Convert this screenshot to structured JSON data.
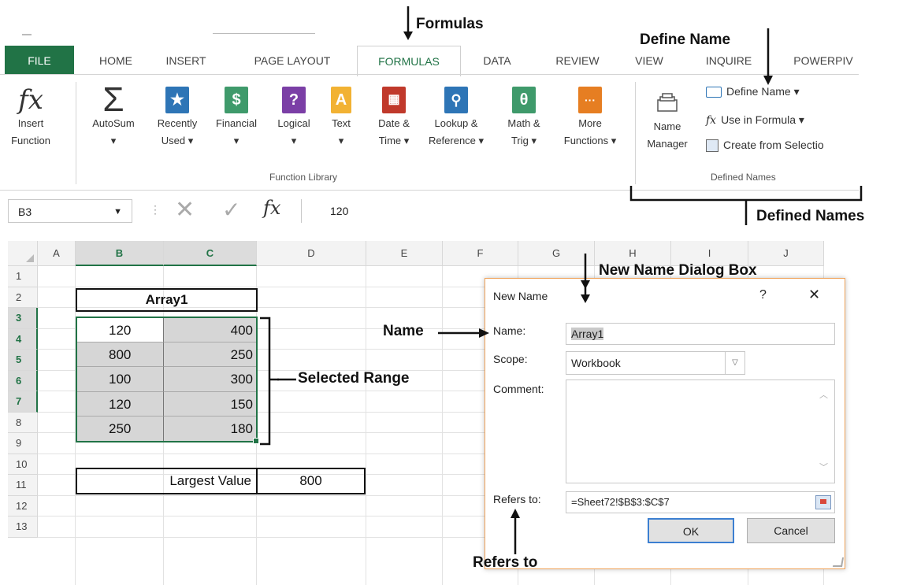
{
  "ribbon": {
    "tabs": [
      "FILE",
      "HOME",
      "INSERT",
      "PAGE LAYOUT",
      "FORMULAS",
      "DATA",
      "REVIEW",
      "VIEW",
      "INQUIRE",
      "POWERPIV"
    ],
    "function_library": {
      "label": "Function Library",
      "buttons": [
        {
          "line1": "Insert",
          "line2": "Function",
          "icon": "fx-icon"
        },
        {
          "line1": "AutoSum",
          "line2": "▾",
          "icon": "sigma-icon"
        },
        {
          "line1": "Recently",
          "line2": "Used ▾",
          "icon": "star-book-icon"
        },
        {
          "line1": "Financial",
          "line2": "▾",
          "icon": "financial-book-icon"
        },
        {
          "line1": "Logical",
          "line2": "▾",
          "icon": "question-book-icon"
        },
        {
          "line1": "Text",
          "line2": "▾",
          "icon": "text-book-icon"
        },
        {
          "line1": "Date &",
          "line2": "Time ▾",
          "icon": "calendar-book-icon"
        },
        {
          "line1": "Lookup &",
          "line2": "Reference ▾",
          "icon": "lookup-book-icon"
        },
        {
          "line1": "Math &",
          "line2": "Trig ▾",
          "icon": "theta-book-icon"
        },
        {
          "line1": "More",
          "line2": "Functions ▾",
          "icon": "more-book-icon"
        }
      ]
    },
    "defined_names": {
      "label": "Defined Names",
      "manager_line1": "Name",
      "manager_line2": "Manager",
      "define_name": "Define Name  ▾",
      "use_in_formula": "Use in Formula ▾",
      "create_from_selection": "Create from Selectio"
    }
  },
  "formula_bar": {
    "name_box": "B3",
    "fx": "fx",
    "value": "120"
  },
  "sheet": {
    "columns": [
      "A",
      "B",
      "C",
      "D",
      "E",
      "F",
      "G",
      "H",
      "I",
      "J"
    ],
    "rows": [
      "1",
      "2",
      "3",
      "4",
      "5",
      "6",
      "7",
      "8",
      "9",
      "10",
      "11",
      "12",
      "13"
    ],
    "array_header": "Array1",
    "table": [
      [
        "120",
        "400"
      ],
      [
        "800",
        "250"
      ],
      [
        "100",
        "300"
      ],
      [
        "120",
        "150"
      ],
      [
        "250",
        "180"
      ]
    ],
    "largest_label": "Largest Value",
    "largest_value": "800"
  },
  "dialog": {
    "title": "New Name",
    "help": "?",
    "close": "✕",
    "name_label": "Name:",
    "name_value": "Array1",
    "scope_label": "Scope:",
    "scope_value": "Workbook",
    "comment_label": "Comment:",
    "refers_label": "Refers to:",
    "refers_value": "=Sheet72!$B$3:$C$7",
    "ok": "OK",
    "cancel": "Cancel"
  },
  "annotations": {
    "formulas": "Formulas",
    "define_name": "Define Name",
    "defined_names": "Defined Names",
    "new_name_dialog": "New Name Dialog Box",
    "name": "Name",
    "selected_range": "Selected Range",
    "refers_to": "Refers to"
  },
  "colors": {
    "excel_green": "#217346",
    "dialog_border": "#f0a35a",
    "selection_gray": "#d6d6d6"
  }
}
